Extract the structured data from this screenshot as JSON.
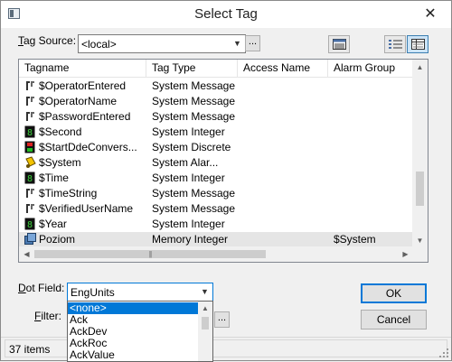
{
  "window": {
    "title": "Select Tag",
    "close_glyph": "✕"
  },
  "tag_source": {
    "label_u": "T",
    "label_rest": "ag Source:",
    "value": "<local>",
    "browse": "..."
  },
  "list": {
    "columns": [
      "Tagname",
      "Tag Type",
      "Access Name",
      "Alarm Group"
    ],
    "rows": [
      {
        "icon": "message-tag-icon",
        "name": "$OperatorEntered",
        "type": "System Message",
        "access": "",
        "alarm": ""
      },
      {
        "icon": "message-tag-icon",
        "name": "$OperatorName",
        "type": "System Message",
        "access": "",
        "alarm": ""
      },
      {
        "icon": "message-tag-icon",
        "name": "$PasswordEntered",
        "type": "System Message",
        "access": "",
        "alarm": ""
      },
      {
        "icon": "integer-tag-icon",
        "name": "$Second",
        "type": "System Integer",
        "access": "",
        "alarm": ""
      },
      {
        "icon": "discrete-tag-icon",
        "name": "$StartDdeConvers...",
        "type": "System Discrete",
        "access": "",
        "alarm": ""
      },
      {
        "icon": "alarm-tag-icon",
        "name": "$System",
        "type": "System Alar...",
        "access": "",
        "alarm": ""
      },
      {
        "icon": "integer-tag-icon",
        "name": "$Time",
        "type": "System Integer",
        "access": "",
        "alarm": ""
      },
      {
        "icon": "message-tag-icon",
        "name": "$TimeString",
        "type": "System Message",
        "access": "",
        "alarm": ""
      },
      {
        "icon": "message-tag-icon",
        "name": "$VerifiedUserName",
        "type": "System Message",
        "access": "",
        "alarm": ""
      },
      {
        "icon": "integer-tag-icon",
        "name": "$Year",
        "type": "System Integer",
        "access": "",
        "alarm": ""
      },
      {
        "icon": "memory-integer-tag-icon",
        "name": "Poziom",
        "type": "Memory Integer",
        "access": "",
        "alarm": "$System"
      }
    ]
  },
  "dot_field": {
    "label_u": "D",
    "label_rest": "ot Field:",
    "value": "EngUnits",
    "options": [
      "<none>",
      "Ack",
      "AckDev",
      "AckRoc",
      "AckValue"
    ],
    "selected_option": "<none>"
  },
  "filter": {
    "label_u": "F",
    "label_rest": "ilter:",
    "browse": "..."
  },
  "buttons": {
    "ok": "OK",
    "cancel": "Cancel"
  },
  "status": {
    "items": "37 items"
  }
}
